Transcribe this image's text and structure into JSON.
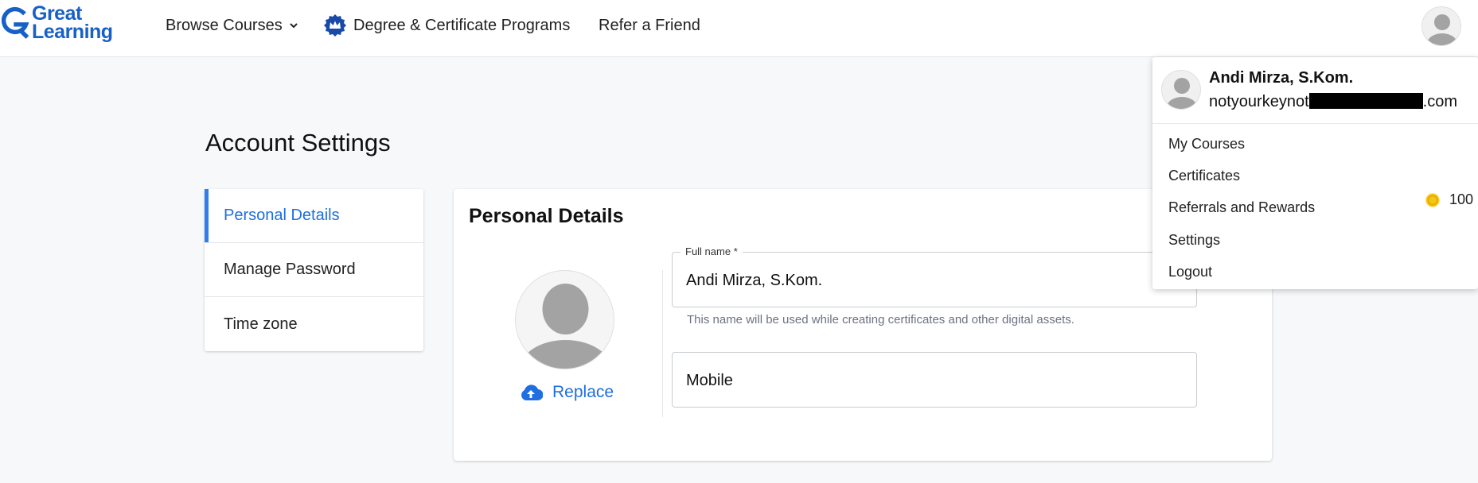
{
  "header": {
    "logo_line1": "Great",
    "logo_line2": "Learning",
    "nav": {
      "browse": "Browse Courses",
      "degree": "Degree & Certificate Programs",
      "refer": "Refer a Friend"
    }
  },
  "page": {
    "title": "Account Settings"
  },
  "sidebar": {
    "items": [
      {
        "label": "Personal Details"
      },
      {
        "label": "Manage Password"
      },
      {
        "label": "Time zone"
      }
    ]
  },
  "personal": {
    "title": "Personal Details",
    "replace_label": "Replace",
    "full_name_label": "Full name *",
    "full_name_value": "Andi Mirza, S.Kom.",
    "full_name_hint": "This name will be used while creating certificates and other digital assets.",
    "mobile_label": "Mobile"
  },
  "dropdown": {
    "user_name": "Andi Mirza, S.Kom.",
    "email_prefix": "notyourkeynot",
    "email_suffix": ".com",
    "items": [
      {
        "label": "My Courses"
      },
      {
        "label": "Certificates"
      },
      {
        "label": "Referrals and Rewards"
      },
      {
        "label": "Settings"
      },
      {
        "label": "Logout"
      }
    ],
    "coins": "100"
  },
  "colors": {
    "brand": "#1760c7",
    "accent": "#1f6fe0",
    "coin": "#f5c518"
  },
  "icons": [
    "chevron-down-icon",
    "crown-icon",
    "avatar-icon",
    "cloud-upload-icon",
    "coin-icon"
  ]
}
